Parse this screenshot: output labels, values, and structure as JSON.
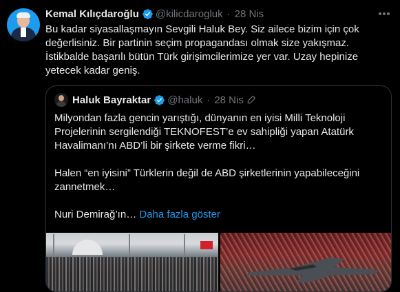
{
  "tweet": {
    "author_name": "Kemal Kılıçdaroğlu",
    "handle": "@kilicdarogluk",
    "date": "28 Nis",
    "separator": "·",
    "text": "Bu kadar siyasallaşmayın Sevgili Haluk Bey. Siz ailece bizim için çok\ndeğerlisiniz. Bir partinin seçim propagandası olmak size yakışmaz.\nİstikbalde başarılı bütün Türk girişimcilerimize yer var. Uzay hepinize\nyetecek kadar geniş."
  },
  "quoted_tweet": {
    "author_name": "Haluk Bayraktar",
    "handle": "@haluk",
    "date": "28 Nis",
    "separator": "·",
    "paragraph_1": "Milyondan fazla gencin yarıştığı, dünyanın en iyisi Milli Teknoloji Projelerinin sergilendiği TEKNOFEST’e ev sahipliği yapan Atatürk Havalimanı’nı ABD’li bir şirkete verme fikri…",
    "paragraph_2": "Halen “en iyisini” Türklerin değil de ABD şirketlerinin yapabileceğini zannetmek…",
    "paragraph_3": "Nuri Demirağ’ın…",
    "show_more": "Daha fazla göster"
  },
  "colors": {
    "background": "#000000",
    "text": "#e7e9ea",
    "muted": "#71767b",
    "accent": "#1d9bf0",
    "border": "#2f3336"
  },
  "icons": {
    "verified": "verified-badge-icon",
    "more": "more-options-icon",
    "edited": "edited-pencil-icon"
  }
}
